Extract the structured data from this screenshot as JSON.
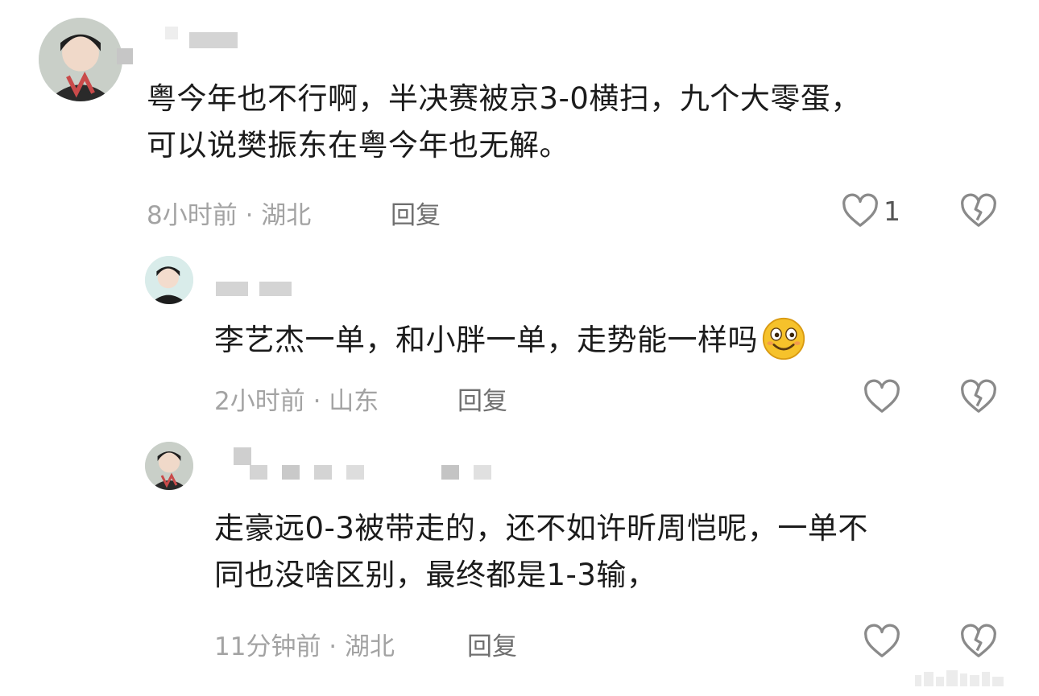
{
  "comments": [
    {
      "text": "粤今年也不行啊，半决赛被京3-0横扫，九个大零蛋，可以说樊振东在粤今年也无解。",
      "line1": "粤今年也不行啊，半决赛被京3-0横扫，九个大零蛋，",
      "line2": "可以说樊振东在粤今年也无解。",
      "meta": "8小时前 · 湖北",
      "reply_label": "回复",
      "like_count": "1"
    },
    {
      "text": "李艺杰一单，和小胖一单，走势能一样吗",
      "line1": "李艺杰一单，和小胖一单，走势能一样吗",
      "meta": "2小时前 · 山东",
      "reply_label": "回复",
      "like_count": ""
    },
    {
      "text": "走豪远0-3被带走的，还不如许昕周恺呢，一单不同也没啥区别，最终都是1-3输，",
      "line1": "走豪远0-3被带走的，还不如许昕周恺呢，一单不",
      "line2": "同也没啥区别，最终都是1-3输，",
      "meta": "11分钟前 · 湖北",
      "reply_label": "回复",
      "like_count": ""
    }
  ],
  "icons": {
    "like": "heart-outline-icon",
    "dislike": "broken-heart-icon",
    "emoji": "smiling-face-emoji"
  },
  "colors": {
    "meta": "#a3a3a3",
    "reply": "#6f6f6f",
    "icon": "#8a8a8a"
  }
}
